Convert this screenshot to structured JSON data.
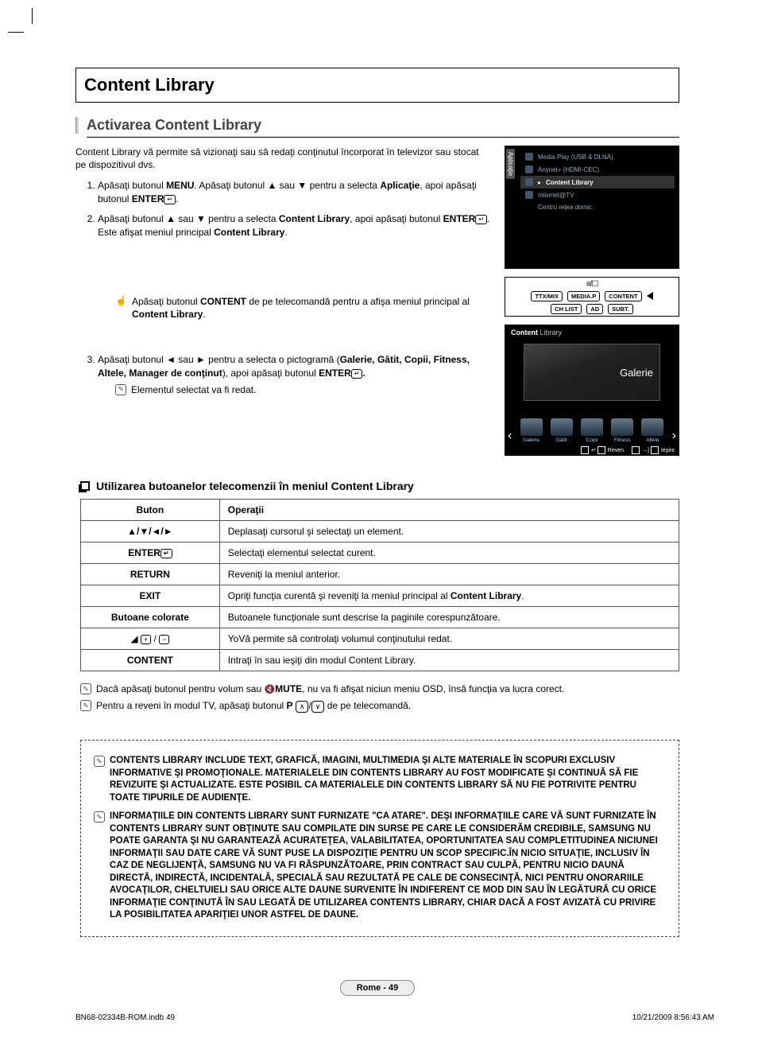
{
  "title": "Content Library",
  "section": "Activarea Content Library",
  "intro": "Content Library vă permite să vizionaţi sau să redaţi conţinutul încorporat în televizor sau stocat pe dispozitivul dvs.",
  "steps": {
    "s1_a": "Apăsaţi butonul ",
    "s1_menu": "MENU",
    "s1_b": ". Apăsaţi butonul ▲ sau ▼ pentru a selecta ",
    "s1_app": "Aplicaţie",
    "s1_c": ", apoi apăsaţi butonul ",
    "s1_enter": "ENTER",
    "s1_d": ".",
    "s2_a": "Apăsaţi butonul ▲ sau ▼ pentru a selecta ",
    "s2_cl": "Content Library",
    "s2_b": ", apoi apăsaţi butonul ",
    "s2_c": ". Este afişat meniul principal ",
    "s2_d": ".",
    "tip1_a": "Apăsaţi butonul ",
    "tip1_b": "CONTENT",
    "tip1_c": " de pe telecomandă pentru a afişa meniul principal al ",
    "tip1_d": "Content Library",
    "tip1_e": ".",
    "s3_a": "Apăsaţi butonul ◄ sau ► pentru a selecta o pictogramă (",
    "s3_list": "Galerie, Gătit, Copii, Fitness, Altele, Manager de conţinut",
    "s3_b": "), apoi apăsaţi butonul ",
    "s3_c": ".",
    "tip2": "Elementul selectat va fi redat."
  },
  "tv_menu": {
    "vtab": "Aplicaţie",
    "i1": "Media Play (USB & DLNA)",
    "i2": "Anynet+ (HDMI-CEC)",
    "i3": "Content Library",
    "i4": "Internet@TV",
    "i5": "Centru reţea domic."
  },
  "remote": {
    "ttx": "TTX/MIX",
    "mediap": "MEDIA.P",
    "content": "CONTENT",
    "chlist": "CH LIST",
    "ad": "AD",
    "subt": "SUBT."
  },
  "cl_screen": {
    "title_a": "Content",
    "title_b": " Library",
    "big": "Galerie",
    "c1": "Galerie",
    "c2": "Gătit",
    "c3": "Copii",
    "c4": "Fitness",
    "c5": "Altele",
    "f1": "Reven.",
    "f2": "Ieşire"
  },
  "table_heading": "Utilizarea butoanelor telecomenzii în meniul Content Library",
  "table": {
    "h1": "Buton",
    "h2": "Operaţii",
    "r1c1": "▲/▼/◄/►",
    "r1c2": "Deplasaţi cursorul şi selectaţi un element.",
    "r2c1": "ENTER",
    "r2c2": "Selectaţi elementul selectat curent.",
    "r3c1": "RETURN",
    "r3c2": "Reveniţi la meniul anterior.",
    "r4c1": "EXIT",
    "r4c2_a": "Opriţi funcţia curentă şi reveniţi la meniul principal al ",
    "r4c2_b": "Content Library",
    "r4c2_c": ".",
    "r5c1": "Butoane colorate",
    "r5c2": "Butoanele funcţionale sunt descrise la paginile corespunzătoare.",
    "r6c2": "YoVă permite să controlaţi volumul conţinutului redat.",
    "r7c1": "CONTENT",
    "r7c2": "Intraţi în sau ieşiţi din modul Content Library."
  },
  "post_notes": {
    "n1_a": "Dacă apăsaţi butonul pentru volum sau ",
    "n1_mute": "MUTE",
    "n1_b": ", nu va fi afişat niciun meniu OSD, însă funcţia va lucra corect.",
    "n2_a": "Pentru a reveni în modul TV, apăsaţi butonul ",
    "n2_p": "P",
    "n2_b": " de pe telecomandă."
  },
  "warnings": {
    "w1": "CONTENTS LIBRARY INCLUDE TEXT, GRAFICĂ, IMAGINI, MULTIMEDIA ŞI ALTE MATERIALE ÎN SCOPURI EXCLUSIV INFORMATIVE ŞI PROMOŢIONALE. MATERIALELE DIN CONTENTS LIBRARY AU FOST MODIFICATE ŞI CONTINUĂ SĂ FIE REVIZUITE ŞI ACTUALIZATE. ESTE POSIBIL CA MATERIALELE DIN CONTENTS LIBRARY SĂ NU FIE POTRIVITE PENTRU TOATE TIPURILE DE AUDIENŢE.",
    "w2": "INFORMAŢIILE DIN CONTENTS LIBRARY SUNT FURNIZATE \"CA ATARE\". DEŞI INFORMAŢIILE CARE VĂ SUNT FURNIZATE ÎN CONTENTS LIBRARY SUNT OBŢINUTE SAU COMPILATE DIN SURSE PE CARE LE CONSIDERĂM CREDIBILE, SAMSUNG NU POATE GARANTA ŞI NU GARANTEAZĂ ACURATEŢEA, VALABILITATEA, OPORTUNITATEA SAU COMPLETITUDINEA NICIUNEI INFORMAŢII SAU DATE CARE VĂ SUNT PUSE LA DISPOZIŢIE PENTRU UN SCOP SPECIFIC.ÎN NICIO SITUAŢIE, INCLUSIV ÎN CAZ DE NEGLIJENŢĂ, SAMSUNG NU VA FI RĂSPUNZĂTOARE, PRIN CONTRACT SAU CULPĂ, PENTRU NICIO DAUNĂ DIRECTĂ, INDIRECTĂ, INCIDENTALĂ, SPECIALĂ SAU REZULTATĂ PE CALE DE CONSECINŢĂ, NICI PENTRU ONORARIILE AVOCAŢILOR, CHELTUIELI SAU ORICE ALTE DAUNE SURVENITE ÎN INDIFERENT CE MOD DIN SAU ÎN LEGĂTURĂ CU ORICE INFORMAŢIE CONŢINUTĂ ÎN SAU LEGATĂ DE UTILIZAREA CONTENTS LIBRARY, CHIAR DACĂ A FOST AVIZATĂ CU PRIVIRE LA POSIBILITATEA APARIŢIEI UNOR ASTFEL DE DAUNE."
  },
  "page_num": "Rome - 49",
  "footer_l": "BN68-02334B-ROM.indb   49",
  "footer_r": "10/21/2009   8:56:43 AM"
}
